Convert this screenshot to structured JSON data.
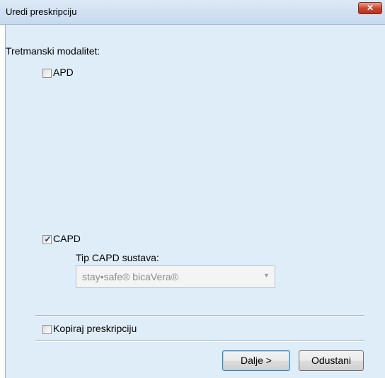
{
  "window": {
    "title": "Uredi preskripciju",
    "close_label": "✕"
  },
  "form": {
    "modality_label": "Tretmanski modalitet:",
    "apd": {
      "label": "APD",
      "checked": false
    },
    "capd": {
      "label": "CAPD",
      "checked": true
    },
    "capd_system_label": "Tip CAPD sustava:",
    "capd_system_value": "stay•safe® bicaVera®",
    "copy_prescription": {
      "label": "Kopiraj preskripciju",
      "checked": false
    }
  },
  "buttons": {
    "next": "Dalje >",
    "cancel": "Odustani"
  },
  "colors": {
    "client_background": "#dfedf9",
    "close_button": "#c9482f"
  }
}
